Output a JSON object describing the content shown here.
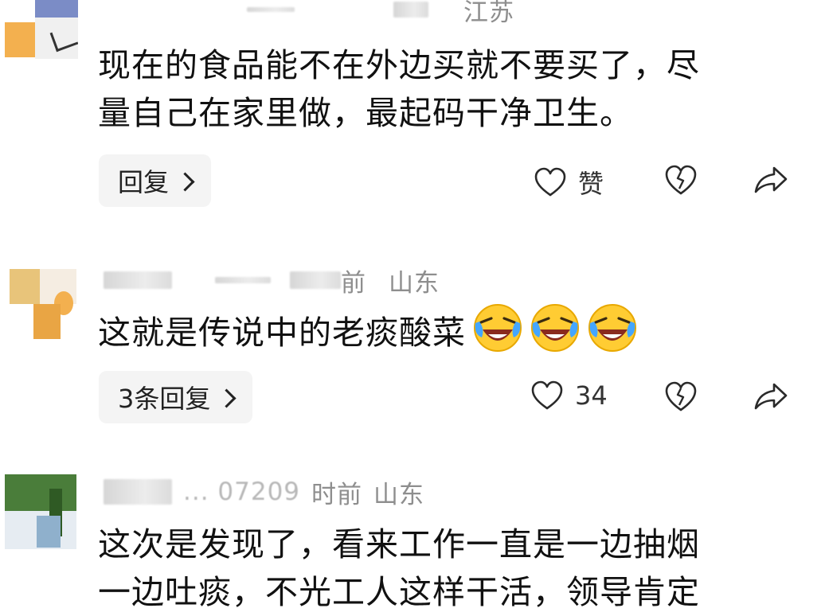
{
  "comments": [
    {
      "location": "江苏",
      "text_line1": "现在的食品能不在外边买就不要买了，尽",
      "text_line2": "量自己在家里做，最起码干净卫生。",
      "reply_label": "回复",
      "like_label": "赞"
    },
    {
      "time": "前",
      "location": "山东",
      "text": "这就是传说中的老痰酸菜",
      "emoji": [
        "laughing-crying-emoji",
        "laughing-crying-emoji",
        "laughing-crying-emoji"
      ],
      "reply_label": "3条回复",
      "like_count": "34"
    },
    {
      "id_partial": "... 07209",
      "time": "时前",
      "location": "山东",
      "text_line1": "这次是发现了，看来工作一直是一边抽烟",
      "text_line2": "一边吐痰，不光工人这样干活，领导肯定"
    }
  ],
  "icons": {
    "like": "heart-outline-icon",
    "dislike": "broken-heart-icon",
    "share": "share-arrow-icon"
  },
  "colors": {
    "meta": "#8e8e8e",
    "reply_bg": "#f4f4f4",
    "icon": "#2a2a2a"
  }
}
